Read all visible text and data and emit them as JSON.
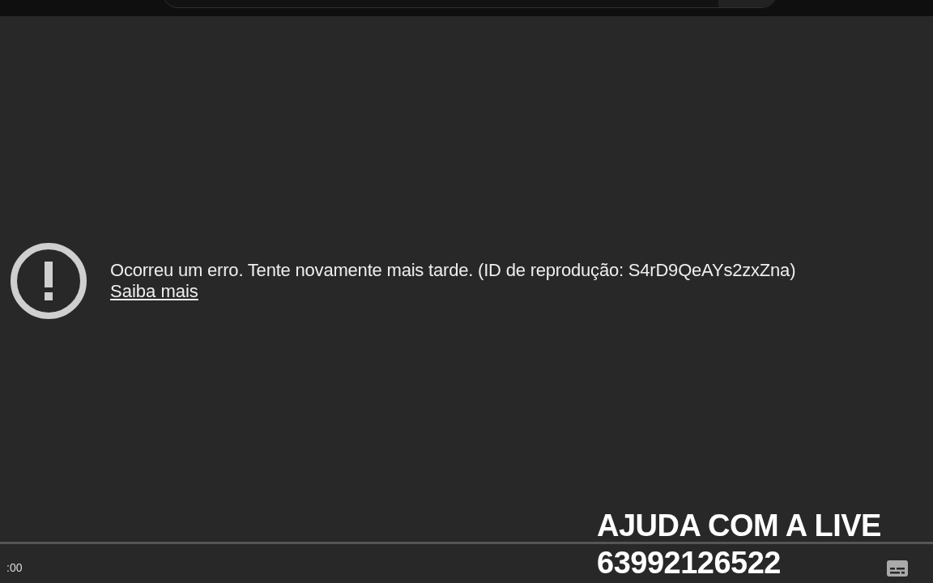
{
  "error": {
    "message": "Ocorreu um erro. Tente novamente mais tarde. (ID de reprodução: S4rD9QeAYs2zxZna)",
    "link": "Saiba mais"
  },
  "overlay": {
    "lines": [
      "AJUDA COM A LIVE",
      "63992126522"
    ]
  },
  "controls": {
    "time": ":00"
  }
}
